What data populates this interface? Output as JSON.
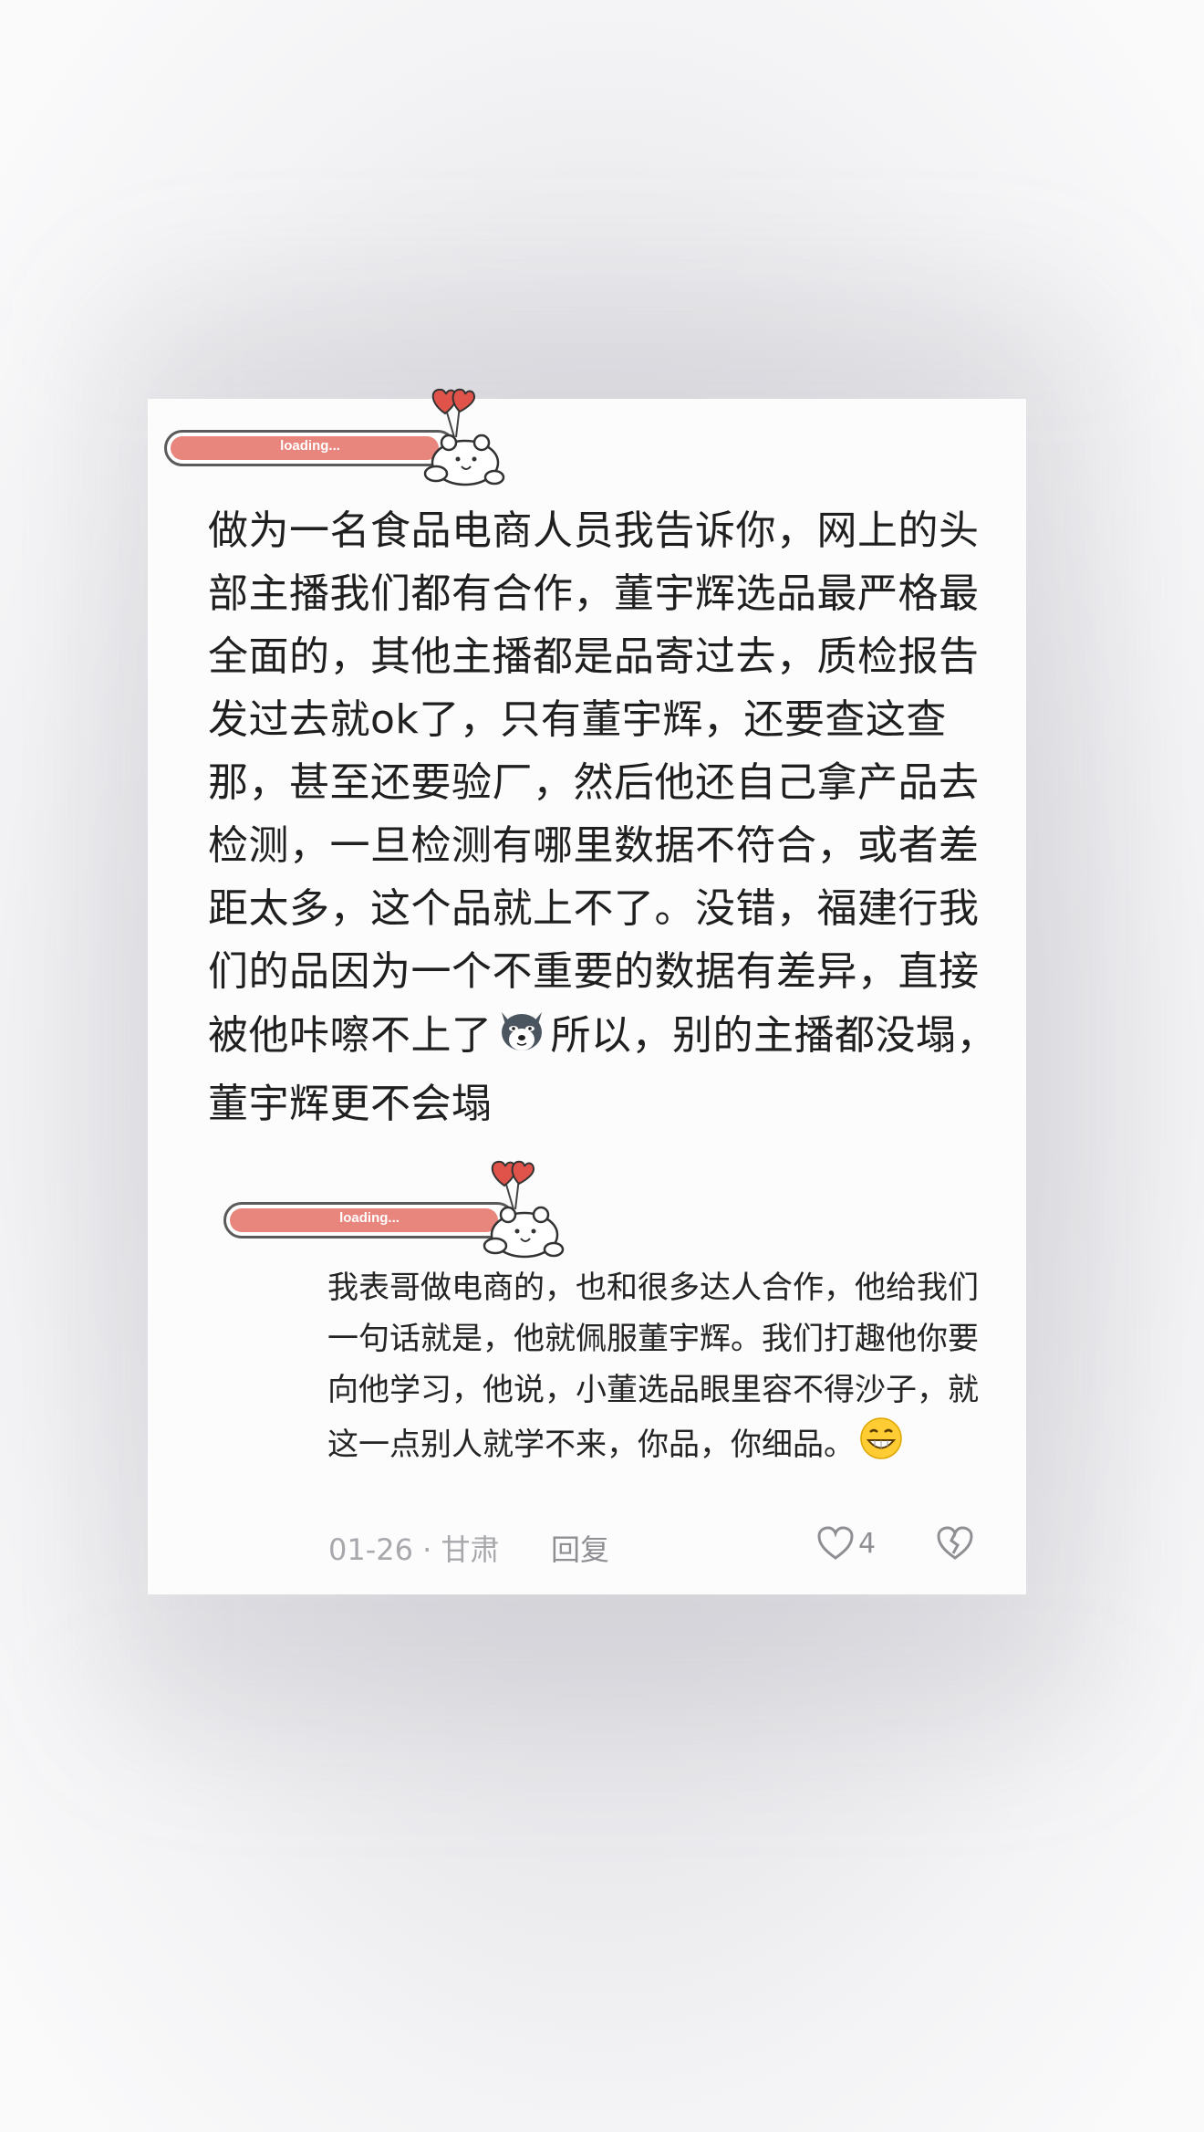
{
  "loader": {
    "text": "loading..."
  },
  "post": {
    "text": "做为一名食品电商人员我告诉你，网上的头部主播我们都有合作，董宇辉选品最严格最全面的，其他主播都是品寄过去，质检报告发过去就ok了，只有董宇辉，还要查这查那，甚至还要验厂，然后他还自己拿产品去检测，一旦检测有哪里数据不符合，或者差距太多，这个品就上不了。没错，福建行我们的品因为一个不重要的数据有差异，直接被他咔嚓不上了",
    "text_after_emoji": "所以，别的主播都没塌，董宇辉更不会塌",
    "emoji": "dog-face-emoji"
  },
  "reply": {
    "text": "我表哥做电商的，也和很多达人合作，他给我们一句话就是，他就佩服董宇辉。我们打趣他你要向他学习，他说，小董选品眼里容不得沙子，就这一点别人就学不来，你品，你细品。",
    "emoji": "grinning-face-emoji"
  },
  "meta": {
    "date": "01-26 · 甘肃",
    "reply_label": "回复",
    "like_count": "4"
  },
  "colors": {
    "accent_bar": "#e8857c",
    "heart": "#e0534a",
    "meta_gray": "#a8a8ac"
  }
}
